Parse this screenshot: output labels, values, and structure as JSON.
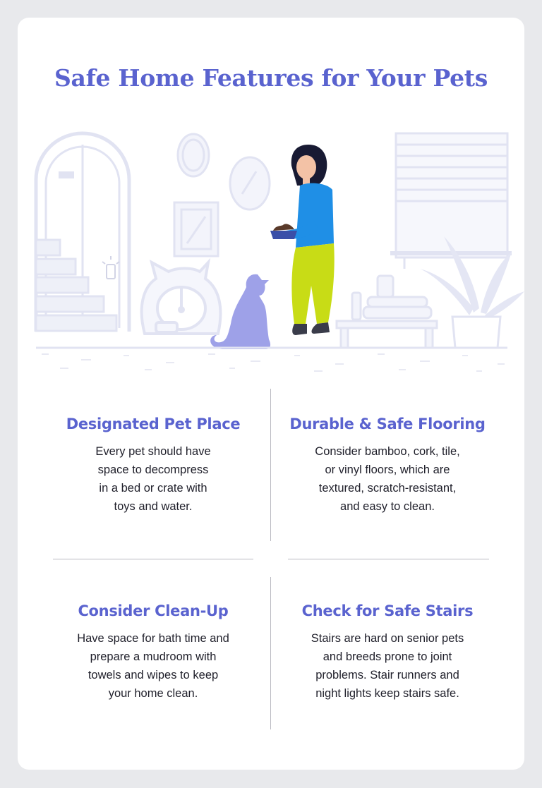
{
  "title": "Safe Home Features for Your Pets",
  "colors": {
    "accent": "#5a63cf",
    "line_art": "#e1e3f2",
    "cat": "#9ea1e8",
    "shirt": "#1f8fe6",
    "pants": "#c8dc16",
    "text": "#1f1f2a"
  },
  "illustration": {
    "icons": [
      "door-icon",
      "stairs-icon",
      "mirror-icon",
      "picture-frame-icon",
      "pet-bed-icon",
      "cat-icon",
      "person-icon",
      "food-bowl-icon",
      "window-blinds-icon",
      "plant-icon",
      "bench-icon"
    ]
  },
  "features": [
    {
      "heading": "Designated Pet Place",
      "body": "Every pet should have\nspace to decompress\nin a bed or crate with\ntoys and water."
    },
    {
      "heading": "Durable & Safe Flooring",
      "body": "Consider bamboo, cork, tile,\nor vinyl floors, which are\ntextured, scratch-resistant,\nand easy to clean."
    },
    {
      "heading": "Consider Clean-Up",
      "body": "Have space for bath time and\nprepare a mudroom with\ntowels and wipes to keep\nyour home clean."
    },
    {
      "heading": "Check for Safe Stairs",
      "body": "Stairs are hard on senior pets\nand breeds prone to joint\nproblems. Stair runners and\nnight lights keep stairs safe."
    }
  ]
}
